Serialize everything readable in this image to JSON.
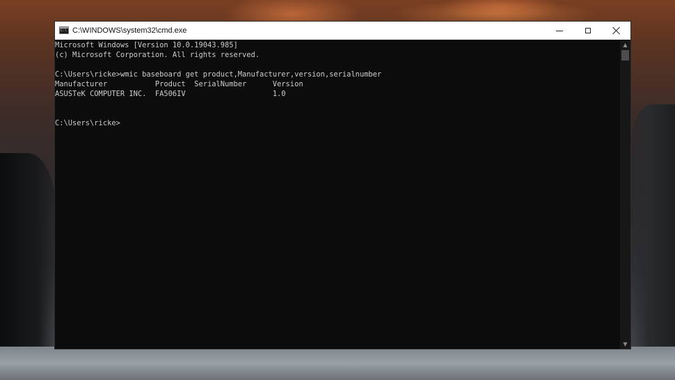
{
  "window": {
    "title": "C:\\WINDOWS\\system32\\cmd.exe",
    "icon": "cmd-console-icon",
    "icon_glyph": "C:\\"
  },
  "controls": {
    "minimize_icon": "minimize-icon",
    "maximize_icon": "maximize-icon",
    "close_icon": "close-icon"
  },
  "console": {
    "lines": [
      "Microsoft Windows [Version 10.0.19043.985]",
      "(c) Microsoft Corporation. All rights reserved.",
      "",
      "C:\\Users\\ricke>wmic baseboard get product,Manufacturer,version,serialnumber",
      "Manufacturer           Product  SerialNumber      Version",
      "ASUSTeK COMPUTER INC.  FA506IV                    1.0",
      "",
      "",
      "C:\\Users\\ricke>"
    ],
    "text_color": "#cccccc",
    "background_color": "#0c0c0c"
  },
  "scrollbar": {
    "up_arrow": "▲",
    "down_arrow": "▼"
  }
}
